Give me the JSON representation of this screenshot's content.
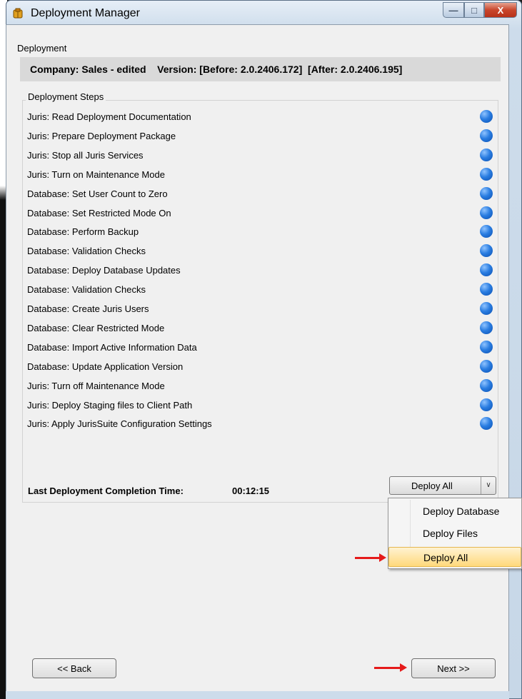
{
  "window": {
    "title": "Deployment Manager",
    "min_glyph": "—",
    "max_glyph": "□",
    "close_glyph": "X"
  },
  "section_label": "Deployment",
  "company_line": "Company: Sales - edited    Version: [Before: 2.0.2406.172]  [After: 2.0.2406.195]",
  "steps_group_title": "Deployment Steps",
  "steps": [
    "Juris:  Read Deployment Documentation",
    "Juris:  Prepare Deployment Package",
    "Juris:  Stop all Juris Services",
    "Juris:  Turn on Maintenance Mode",
    "Database:  Set User Count to Zero",
    "Database:  Set Restricted  Mode On",
    "Database:  Perform Backup",
    "Database:  Validation Checks",
    "Database:  Deploy Database Updates",
    "Database:  Validation Checks",
    "Database:  Create Juris Users",
    "Database:  Clear Restricted  Mode",
    "Database:  Import Active Information Data",
    "Database:  Update Application Version",
    "Juris:  Turn off Maintenance Mode",
    "Juris:  Deploy Staging files to Client Path",
    "Juris:  Apply JurisSuite Configuration Settings"
  ],
  "status_color": "#1f6fd6",
  "completion": {
    "label": "Last Deployment Completion Time:",
    "value": "00:12:15"
  },
  "deploy_combo": {
    "selected": "Deploy All",
    "arrow": "∨"
  },
  "deploy_menu": [
    {
      "label": "Deploy Database",
      "highlighted": false
    },
    {
      "label": "Deploy Files",
      "highlighted": false
    },
    {
      "label": "Deploy All",
      "highlighted": true
    }
  ],
  "nav": {
    "back": "<< Back",
    "next": "Next >>"
  },
  "annotation_color": "#e51a1a"
}
